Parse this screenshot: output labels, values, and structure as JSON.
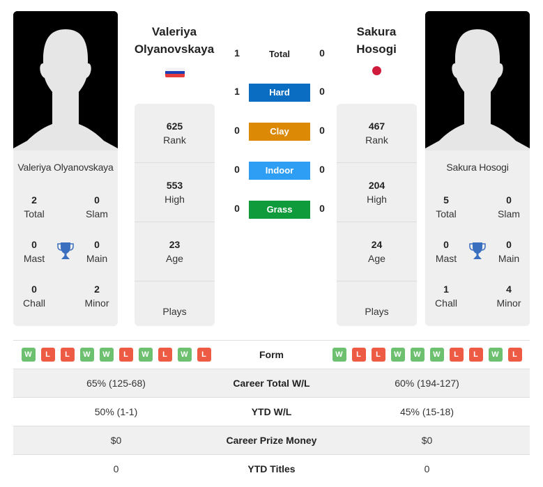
{
  "players": [
    {
      "name": "Valeriya Olyanovskaya",
      "name_line1": "Valeriya",
      "name_line2": "Olyanovskaya",
      "flag": "russia-flag",
      "titles": {
        "total": {
          "value": "2",
          "label": "Total"
        },
        "slam": {
          "value": "0",
          "label": "Slam"
        },
        "mast": {
          "value": "0",
          "label": "Mast"
        },
        "main": {
          "value": "0",
          "label": "Main"
        },
        "chall": {
          "value": "0",
          "label": "Chall"
        },
        "minor": {
          "value": "2",
          "label": "Minor"
        }
      },
      "stats": {
        "rank": {
          "value": "625",
          "label": "Rank"
        },
        "high": {
          "value": "553",
          "label": "High"
        },
        "age": {
          "value": "23",
          "label": "Age"
        },
        "plays": {
          "value": "",
          "label": "Plays"
        }
      },
      "form": [
        "W",
        "L",
        "L",
        "W",
        "W",
        "L",
        "W",
        "L",
        "W",
        "L"
      ]
    },
    {
      "name": "Sakura Hosogi",
      "name_line1": "Sakura",
      "name_line2": "Hosogi",
      "flag": "japan-flag",
      "titles": {
        "total": {
          "value": "5",
          "label": "Total"
        },
        "slam": {
          "value": "0",
          "label": "Slam"
        },
        "mast": {
          "value": "0",
          "label": "Mast"
        },
        "main": {
          "value": "0",
          "label": "Main"
        },
        "chall": {
          "value": "1",
          "label": "Chall"
        },
        "minor": {
          "value": "4",
          "label": "Minor"
        }
      },
      "stats": {
        "rank": {
          "value": "467",
          "label": "Rank"
        },
        "high": {
          "value": "204",
          "label": "High"
        },
        "age": {
          "value": "24",
          "label": "Age"
        },
        "plays": {
          "value": "",
          "label": "Plays"
        }
      },
      "form": [
        "W",
        "L",
        "L",
        "W",
        "W",
        "W",
        "L",
        "L",
        "W",
        "L"
      ]
    }
  ],
  "h2h": [
    {
      "label": "Total",
      "left": "1",
      "right": "0",
      "color": ""
    },
    {
      "label": "Hard",
      "left": "1",
      "right": "0",
      "color": "#0a6dc2"
    },
    {
      "label": "Clay",
      "left": "0",
      "right": "0",
      "color": "#dc8a05"
    },
    {
      "label": "Indoor",
      "left": "0",
      "right": "0",
      "color": "#2e9ef5"
    },
    {
      "label": "Grass",
      "left": "0",
      "right": "0",
      "color": "#0f9a3b"
    }
  ],
  "comparison": {
    "form_label": "Form",
    "rows": [
      {
        "label": "Career Total W/L",
        "left": "65% (125-68)",
        "right": "60% (194-127)"
      },
      {
        "label": "YTD W/L",
        "left": "50% (1-1)",
        "right": "45% (15-18)"
      },
      {
        "label": "Career Prize Money",
        "left": "$0",
        "right": "$0"
      },
      {
        "label": "YTD Titles",
        "left": "0",
        "right": "0"
      }
    ]
  },
  "colors": {
    "win": "#6cc070",
    "loss": "#ee5b45",
    "trophy": "#3a6fbf"
  }
}
